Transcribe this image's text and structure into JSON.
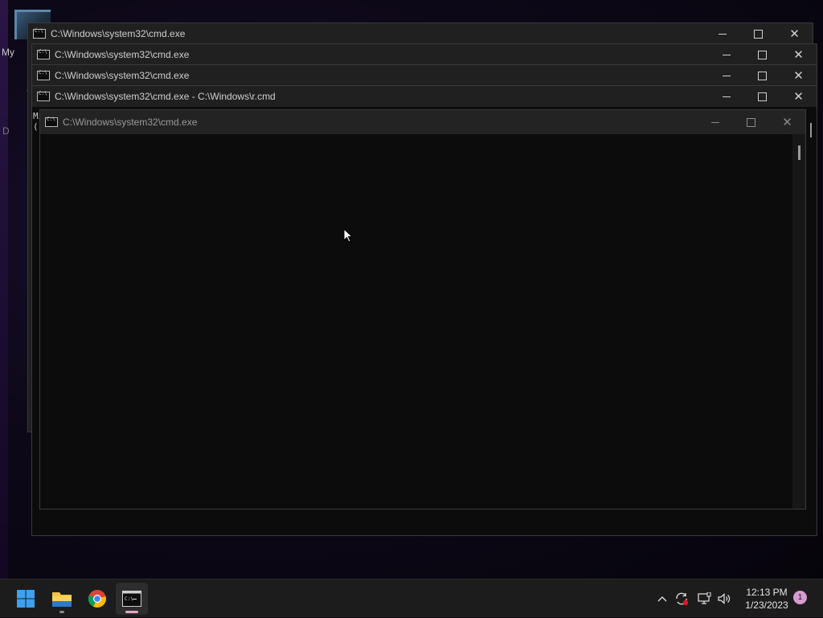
{
  "desktop": {
    "texts": [
      "My",
      "M",
      "G",
      "D"
    ]
  },
  "windows": [
    {
      "title": "C:\\Windows\\system32\\cmd.exe"
    },
    {
      "title": "C:\\Windows\\system32\\cmd.exe"
    },
    {
      "title": "C:\\Windows\\system32\\cmd.exe"
    },
    {
      "title": "C:\\Windows\\system32\\cmd.exe - C:\\Windows\\r.cmd"
    },
    {
      "title": "C:\\Windows\\system32\\cmd.exe"
    }
  ],
  "background_console_text": [
    "Mi",
    "(("
  ],
  "window_controls": {
    "minimize": "—",
    "maximize": "☐",
    "close": "✕"
  },
  "taskbar": {
    "apps": [
      {
        "name": "start",
        "icon": "windows-logo-icon"
      },
      {
        "name": "file-explorer",
        "icon": "folder-icon"
      },
      {
        "name": "chrome",
        "icon": "chrome-icon"
      },
      {
        "name": "command-prompt",
        "icon": "terminal-icon"
      }
    ],
    "tray": {
      "chevron": "^",
      "clock_time": "12:13 PM",
      "clock_date": "1/23/2023",
      "notification_count": "1"
    }
  },
  "colors": {
    "titlebar": "#202020",
    "console_bg": "#0c0c0c",
    "taskbar_bg": "#1c1c1c",
    "accent_badge": "#d69bd0",
    "start_blue": "#3ea0f0"
  }
}
